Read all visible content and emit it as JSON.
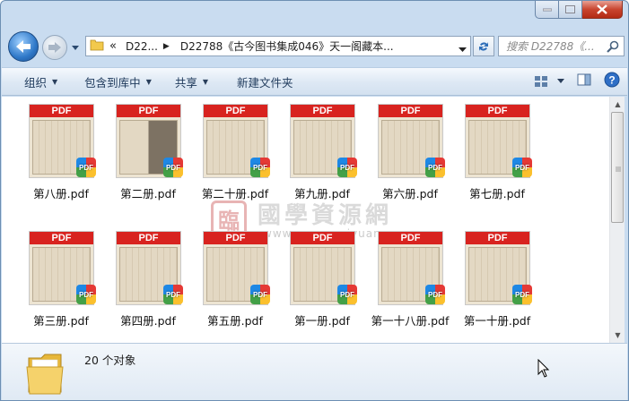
{
  "window": {
    "caption_buttons": [
      "minimize",
      "maximize",
      "close"
    ]
  },
  "nav": {
    "breadcrumb_prefix": "«",
    "crumbs": [
      "D22...",
      "D22788《古今图书集成046》天一阁藏本..."
    ],
    "search_placeholder": "搜索 D22788《..."
  },
  "toolbar": {
    "organize": "组织",
    "include_in_library": "包含到库中",
    "share": "共享",
    "new_folder": "新建文件夹"
  },
  "files": [
    {
      "name": "第八册.pdf",
      "band": "PDF",
      "badge": "PDF"
    },
    {
      "name": "第二册.pdf",
      "band": "PDF",
      "badge": "PDF"
    },
    {
      "name": "第二十册.pdf",
      "band": "PDF",
      "badge": "PDF"
    },
    {
      "name": "第九册.pdf",
      "band": "PDF",
      "badge": "PDF"
    },
    {
      "name": "第六册.pdf",
      "band": "PDF",
      "badge": "PDF"
    },
    {
      "name": "第七册.pdf",
      "band": "PDF",
      "badge": "PDF"
    },
    {
      "name": "第三册.pdf",
      "band": "PDF",
      "badge": "PDF"
    },
    {
      "name": "第四册.pdf",
      "band": "PDF",
      "badge": "PDF"
    },
    {
      "name": "第五册.pdf",
      "band": "PDF",
      "badge": "PDF"
    },
    {
      "name": "第一册.pdf",
      "band": "PDF",
      "badge": "PDF"
    },
    {
      "name": "第一十八册.pdf",
      "band": "PDF",
      "badge": "PDF"
    },
    {
      "name": "第一十册.pdf",
      "band": "PDF",
      "badge": "PDF"
    }
  ],
  "watermark": {
    "seal": "臨",
    "text": "國學資源網",
    "url": "www.guoxueziyuan.com"
  },
  "status": {
    "item_count": "20 个对象"
  },
  "colors": {
    "pdf_band": "#d8231f",
    "toolbar_text": "#1e395b",
    "frame": "#c9dcf0"
  }
}
